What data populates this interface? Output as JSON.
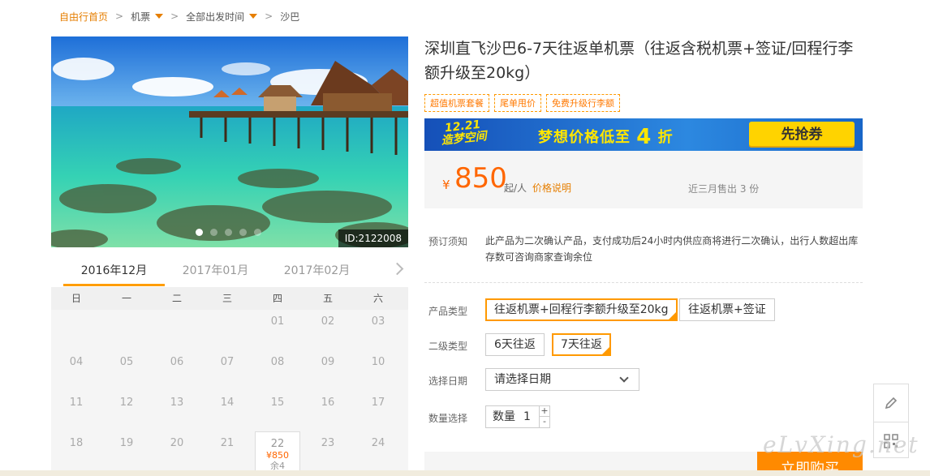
{
  "breadcrumb": {
    "home": "自由行首页",
    "sep": ">",
    "category": "机票",
    "departure": "全部出发时间",
    "destination": "沙巴"
  },
  "hero": {
    "product_id": "ID:2122008",
    "slides_total": 5,
    "slide_active": 1
  },
  "calendar": {
    "months": [
      "2016年12月",
      "2017年01月",
      "2017年02月"
    ],
    "active_month": "2016年12月",
    "weekdays": [
      "日",
      "一",
      "二",
      "三",
      "四",
      "五",
      "六"
    ],
    "days": [
      "",
      "",
      "",
      "",
      "01",
      "02",
      "03",
      "04",
      "05",
      "06",
      "07",
      "08",
      "09",
      "10",
      "11",
      "12",
      "13",
      "14",
      "15",
      "16",
      "17",
      "18",
      "19",
      "20",
      "21",
      "22",
      "23",
      "24"
    ],
    "priced_day": {
      "day": "22",
      "price": "¥850",
      "stock": "余4"
    }
  },
  "product": {
    "title": "深圳直飞沙巴6-7天往返单机票（往返含税机票+签证/回程行李额升级至20kg）",
    "tags": [
      "超值机票套餐",
      "尾单甩价",
      "免费升级行李额"
    ]
  },
  "banner": {
    "logo_line1": "12.21",
    "logo_line2": "造梦空间",
    "text": "梦想价格低至",
    "number": "4",
    "suffix": "折",
    "button": "先抢券"
  },
  "price": {
    "currency": "¥",
    "amount": "850",
    "per": "起/人",
    "note": "价格说明",
    "sold": "近三月售出 3 份"
  },
  "notice": {
    "label": "预订须知",
    "text": "此产品为二次确认产品，支付成功后24小时内供应商将进行二次确认，出行人数超出库存数可咨询商家查询余位"
  },
  "options": {
    "product_type_label": "产品类型",
    "product_types": [
      "往返机票+回程行李额升级至20kg",
      "往返机票+签证"
    ],
    "sub_type_label": "二级类型",
    "sub_types": [
      "6天往返",
      "7天往返"
    ],
    "date_label": "选择日期",
    "date_placeholder": "请选择日期",
    "qty_label": "数量选择",
    "qty_prefix": "数量",
    "qty_value": "1",
    "plus": "+",
    "minus": "-"
  },
  "buy_button": "立即购买",
  "watermark": "eLvXing.net",
  "colors": {
    "accent": "#ff9900",
    "price": "#ff6600",
    "banner": "#1f6fd0"
  }
}
